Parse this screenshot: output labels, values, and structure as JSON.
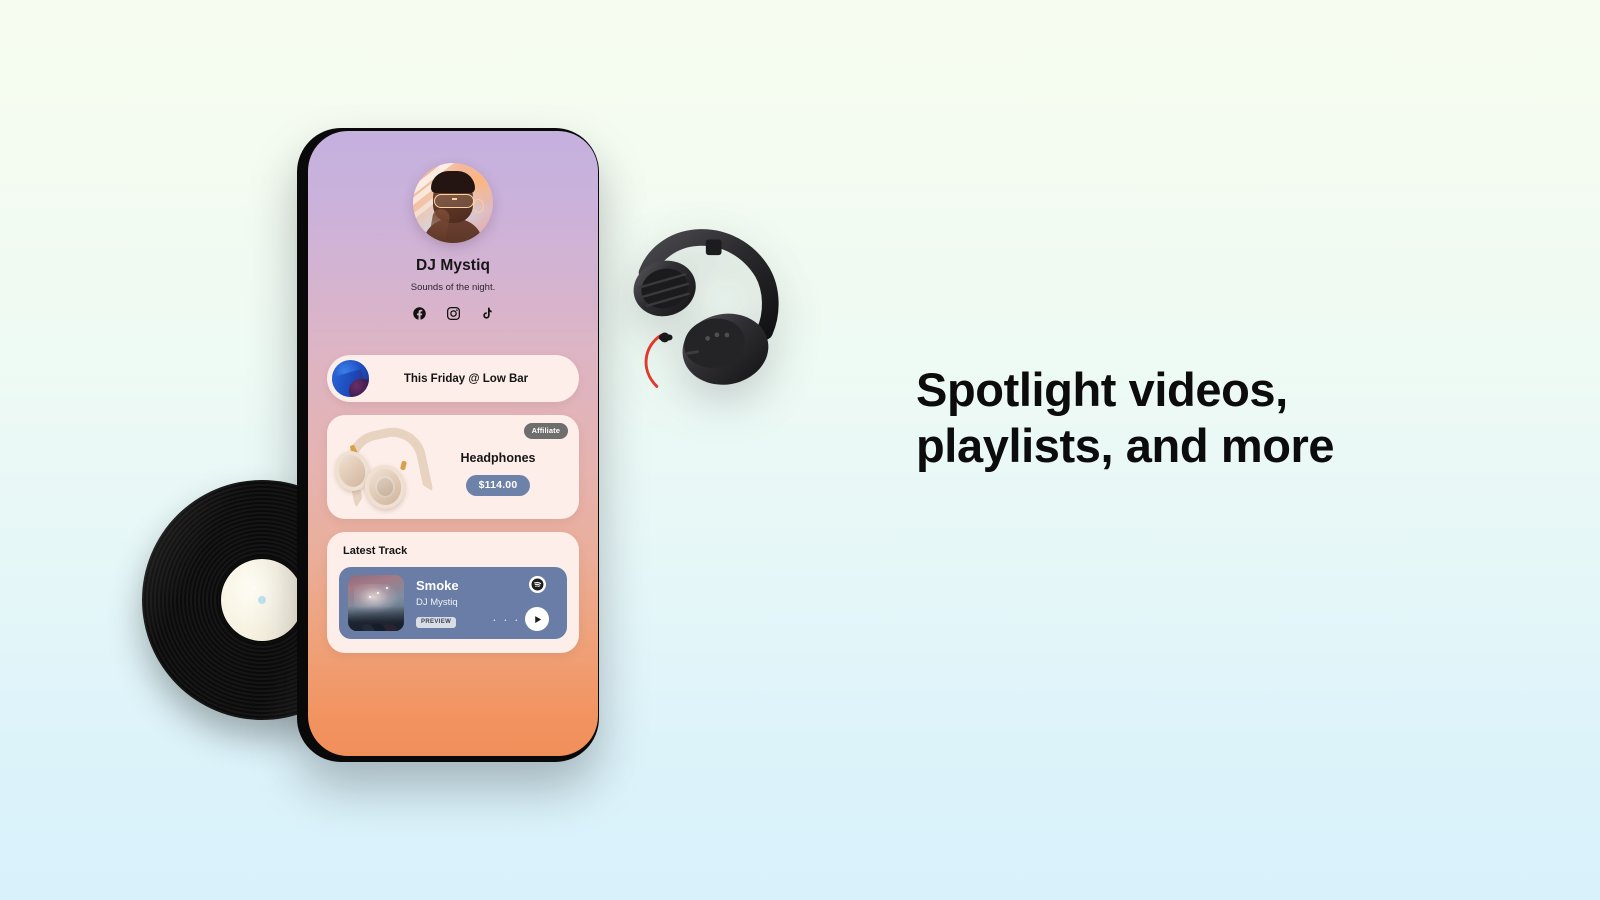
{
  "background": {
    "gradient_top": "#f6fcef",
    "gradient_bottom": "#d8f1fb"
  },
  "headline": {
    "line1": "Spotlight videos,",
    "line2": "playlists, and more",
    "color": "#0c0c0c"
  },
  "phone": {
    "screen_gradient_top": "#c5b1de",
    "screen_gradient_bottom": "#f18f5a",
    "profile": {
      "avatar_alt": "DJ Mystiq portrait",
      "display_name": "DJ Mystiq",
      "tagline": "Sounds of the night.",
      "socials": [
        {
          "name": "facebook-icon",
          "label": "Facebook"
        },
        {
          "name": "instagram-icon",
          "label": "Instagram"
        },
        {
          "name": "tiktok-icon",
          "label": "TikTok"
        }
      ]
    },
    "event_card": {
      "thumbnail_alt": "Event artwork",
      "title": "This Friday @ Low Bar"
    },
    "product_card": {
      "badge": "Affiliate",
      "badge_bg": "#6e6e6e",
      "image_alt": "Beige over-ear headphones",
      "name": "Headphones",
      "price": "$114.00",
      "price_bg": "#6e81a8"
    },
    "track_card": {
      "heading": "Latest Track",
      "player_bg": "#6a7da6",
      "album_art_alt": "Concert crowd artwork",
      "title": "Smoke",
      "artist": "DJ Mystiq",
      "preview_label": "PREVIEW",
      "more_label": "· · ·",
      "spotify_icon": "spotify-icon",
      "play_icon": "play-icon"
    }
  },
  "props": {
    "vinyl_record": "vinyl-record-prop",
    "headphones": "headphones-prop"
  }
}
